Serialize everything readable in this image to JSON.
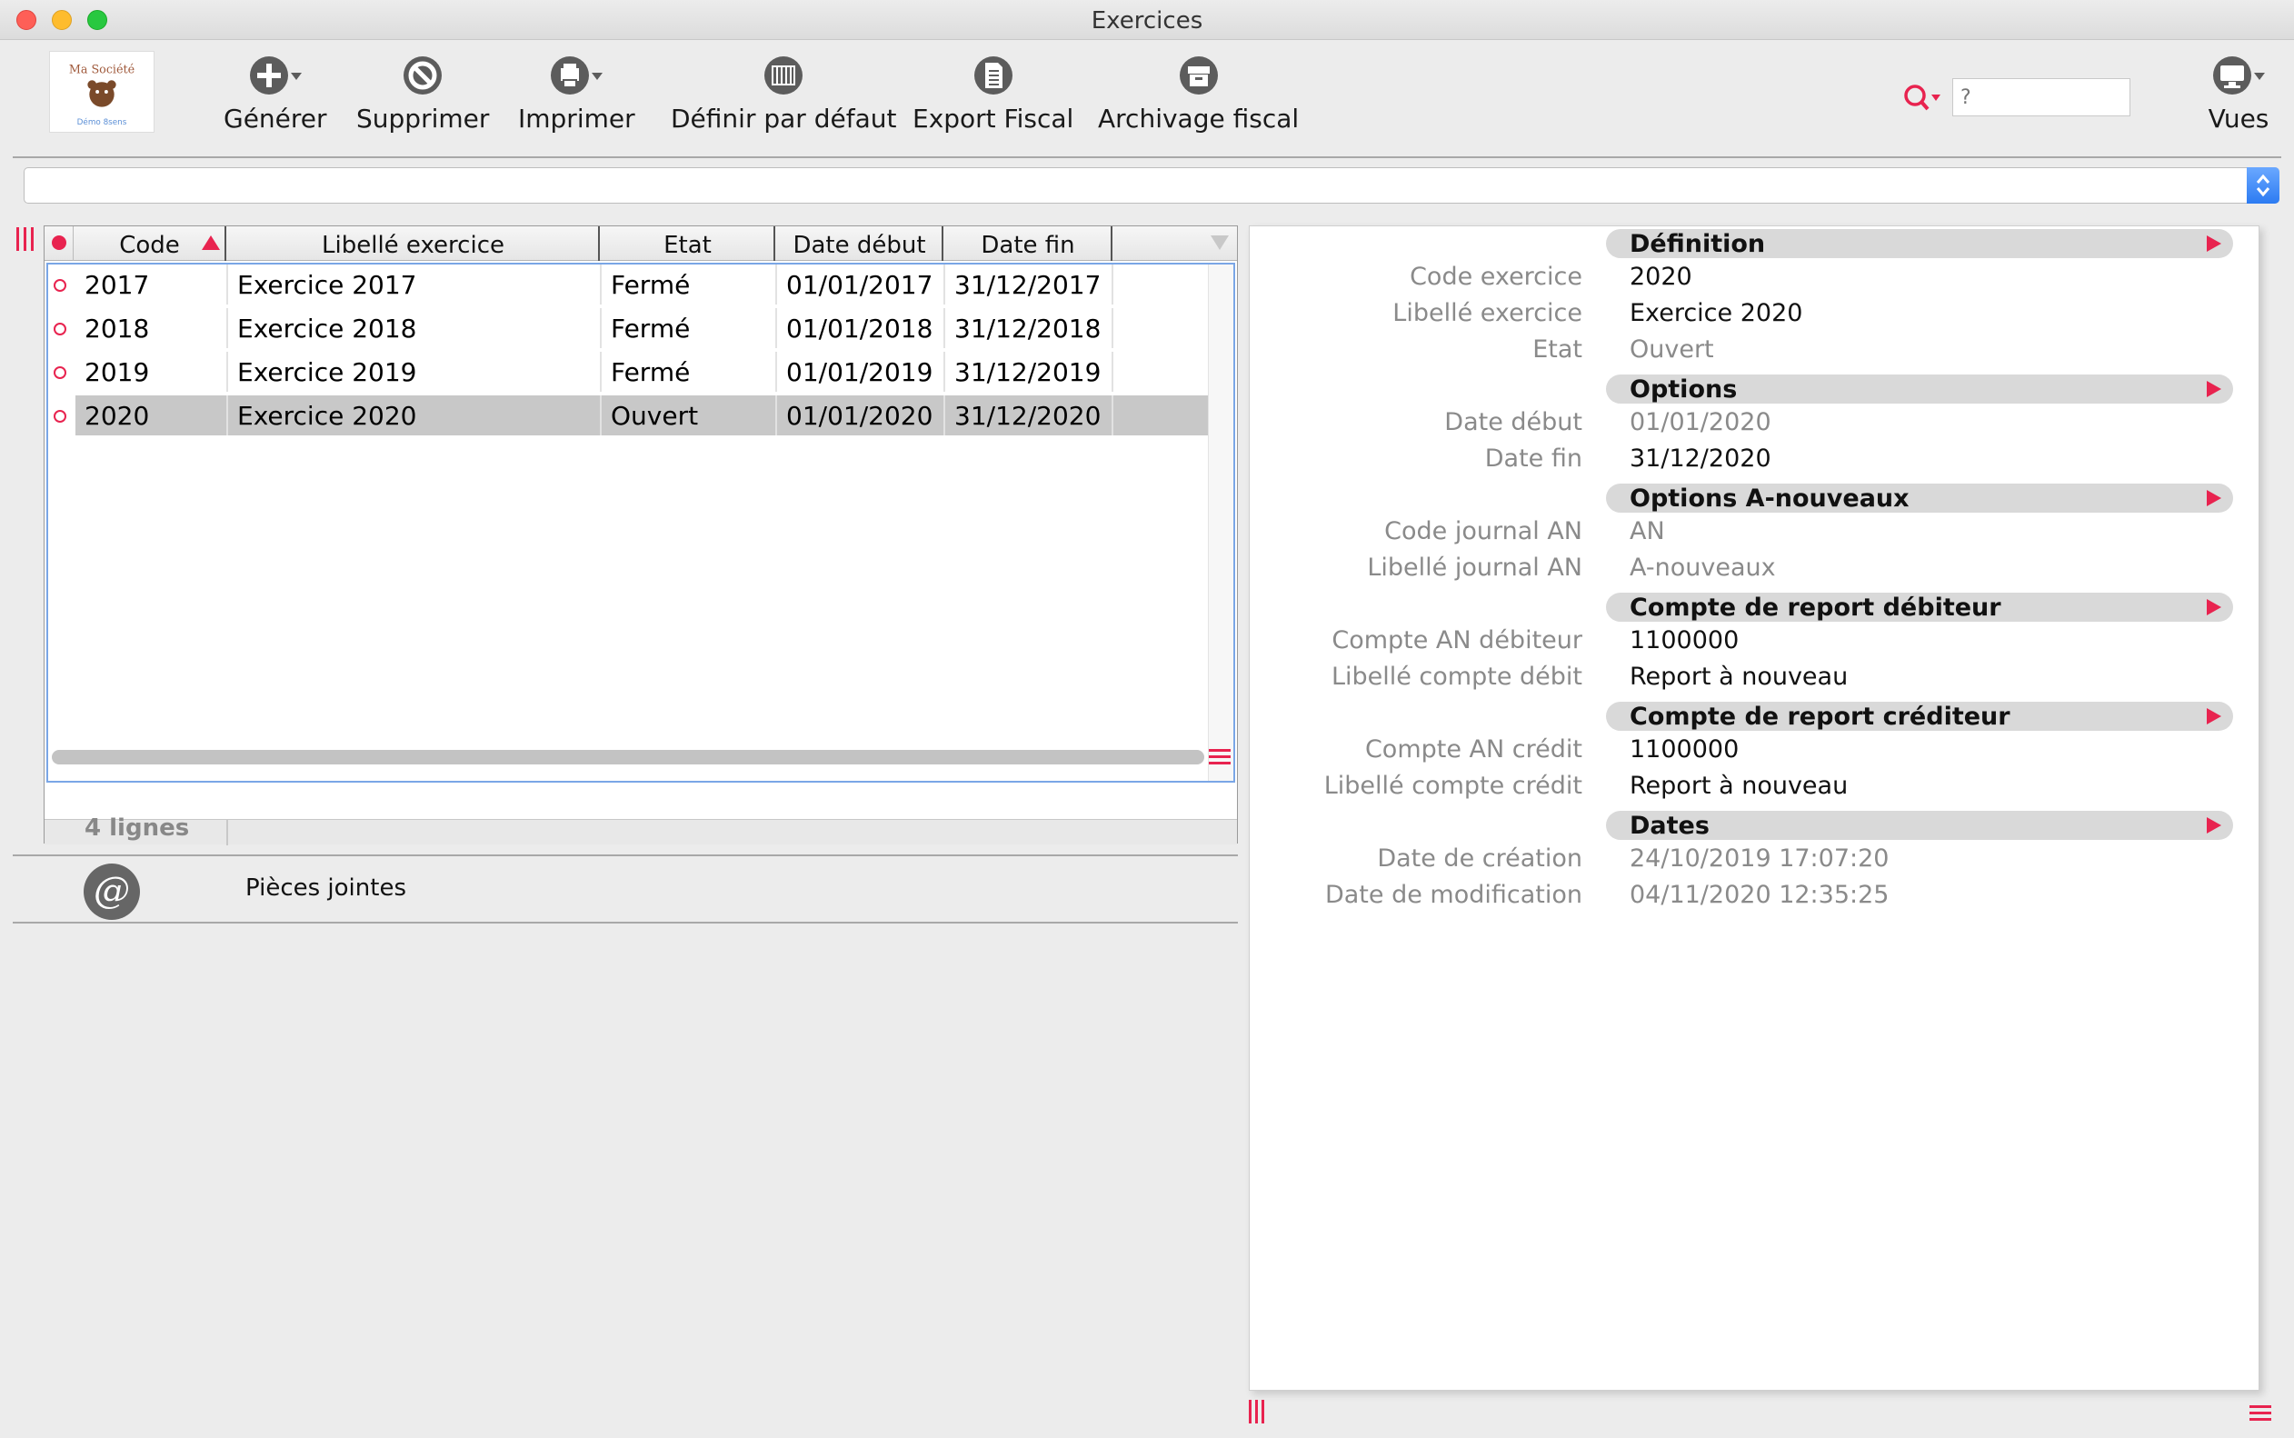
{
  "window": {
    "title": "Exercices"
  },
  "logo": {
    "name": "Ma Société",
    "tagline": "Démo 8sens"
  },
  "toolbar": {
    "generer": "Générer",
    "supprimer": "Supprimer",
    "imprimer": "Imprimer",
    "definir": "Définir par défaut",
    "export": "Export Fiscal",
    "archivage": "Archivage fiscal",
    "vues": "Vues"
  },
  "search": {
    "placeholder": "?"
  },
  "table": {
    "columns": [
      "Code",
      "Libellé exercice",
      "Etat",
      "Date début",
      "Date fin"
    ],
    "rows": [
      {
        "code": "2017",
        "libelle": "Exercice 2017",
        "etat": "Fermé",
        "debut": "01/01/2017",
        "fin": "31/12/2017"
      },
      {
        "code": "2018",
        "libelle": "Exercice 2018",
        "etat": "Fermé",
        "debut": "01/01/2018",
        "fin": "31/12/2018"
      },
      {
        "code": "2019",
        "libelle": "Exercice 2019",
        "etat": "Fermé",
        "debut": "01/01/2019",
        "fin": "31/12/2019"
      },
      {
        "code": "2020",
        "libelle": "Exercice 2020",
        "etat": "Ouvert",
        "debut": "01/01/2020",
        "fin": "31/12/2020"
      }
    ],
    "selected_row": 3,
    "footer": "4 lignes"
  },
  "attachments": {
    "label": "Pièces jointes",
    "icon": "@"
  },
  "form": {
    "sections": {
      "definition": "Définition",
      "options": "Options",
      "options_an": "Options A-nouveaux",
      "report_debiteur": "Compte de report débiteur",
      "report_crediteur": "Compte de report créditeur",
      "dates": "Dates"
    },
    "fields": {
      "code_exercice": {
        "label": "Code exercice",
        "value": "2020"
      },
      "libelle_exercice": {
        "label": "Libellé exercice",
        "value": "Exercice 2020"
      },
      "etat": {
        "label": "Etat",
        "value": "Ouvert"
      },
      "date_debut": {
        "label": "Date début",
        "value": "01/01/2020"
      },
      "date_fin": {
        "label": "Date fin",
        "value": "31/12/2020"
      },
      "code_journal_an": {
        "label": "Code journal AN",
        "value": "AN"
      },
      "libelle_journal_an": {
        "label": "Libellé journal AN",
        "value": "A-nouveaux"
      },
      "compte_an_debiteur": {
        "label": "Compte AN débiteur",
        "value": "1100000"
      },
      "libelle_compte_debit": {
        "label": "Libellé compte débit",
        "value": "Report à nouveau"
      },
      "compte_an_credit": {
        "label": "Compte AN crédit",
        "value": "1100000"
      },
      "libelle_compte_credit": {
        "label": "Libellé compte crédit",
        "value": "Report à nouveau"
      },
      "date_creation": {
        "label": "Date de création",
        "value": "24/10/2019 17:07:20"
      },
      "date_modification": {
        "label": "Date de modification",
        "value": "04/11/2020 12:35:25"
      }
    }
  },
  "colors": {
    "accent": "#e8234f",
    "selection": "#c8c8c8",
    "focus": "#7aa6e6"
  }
}
